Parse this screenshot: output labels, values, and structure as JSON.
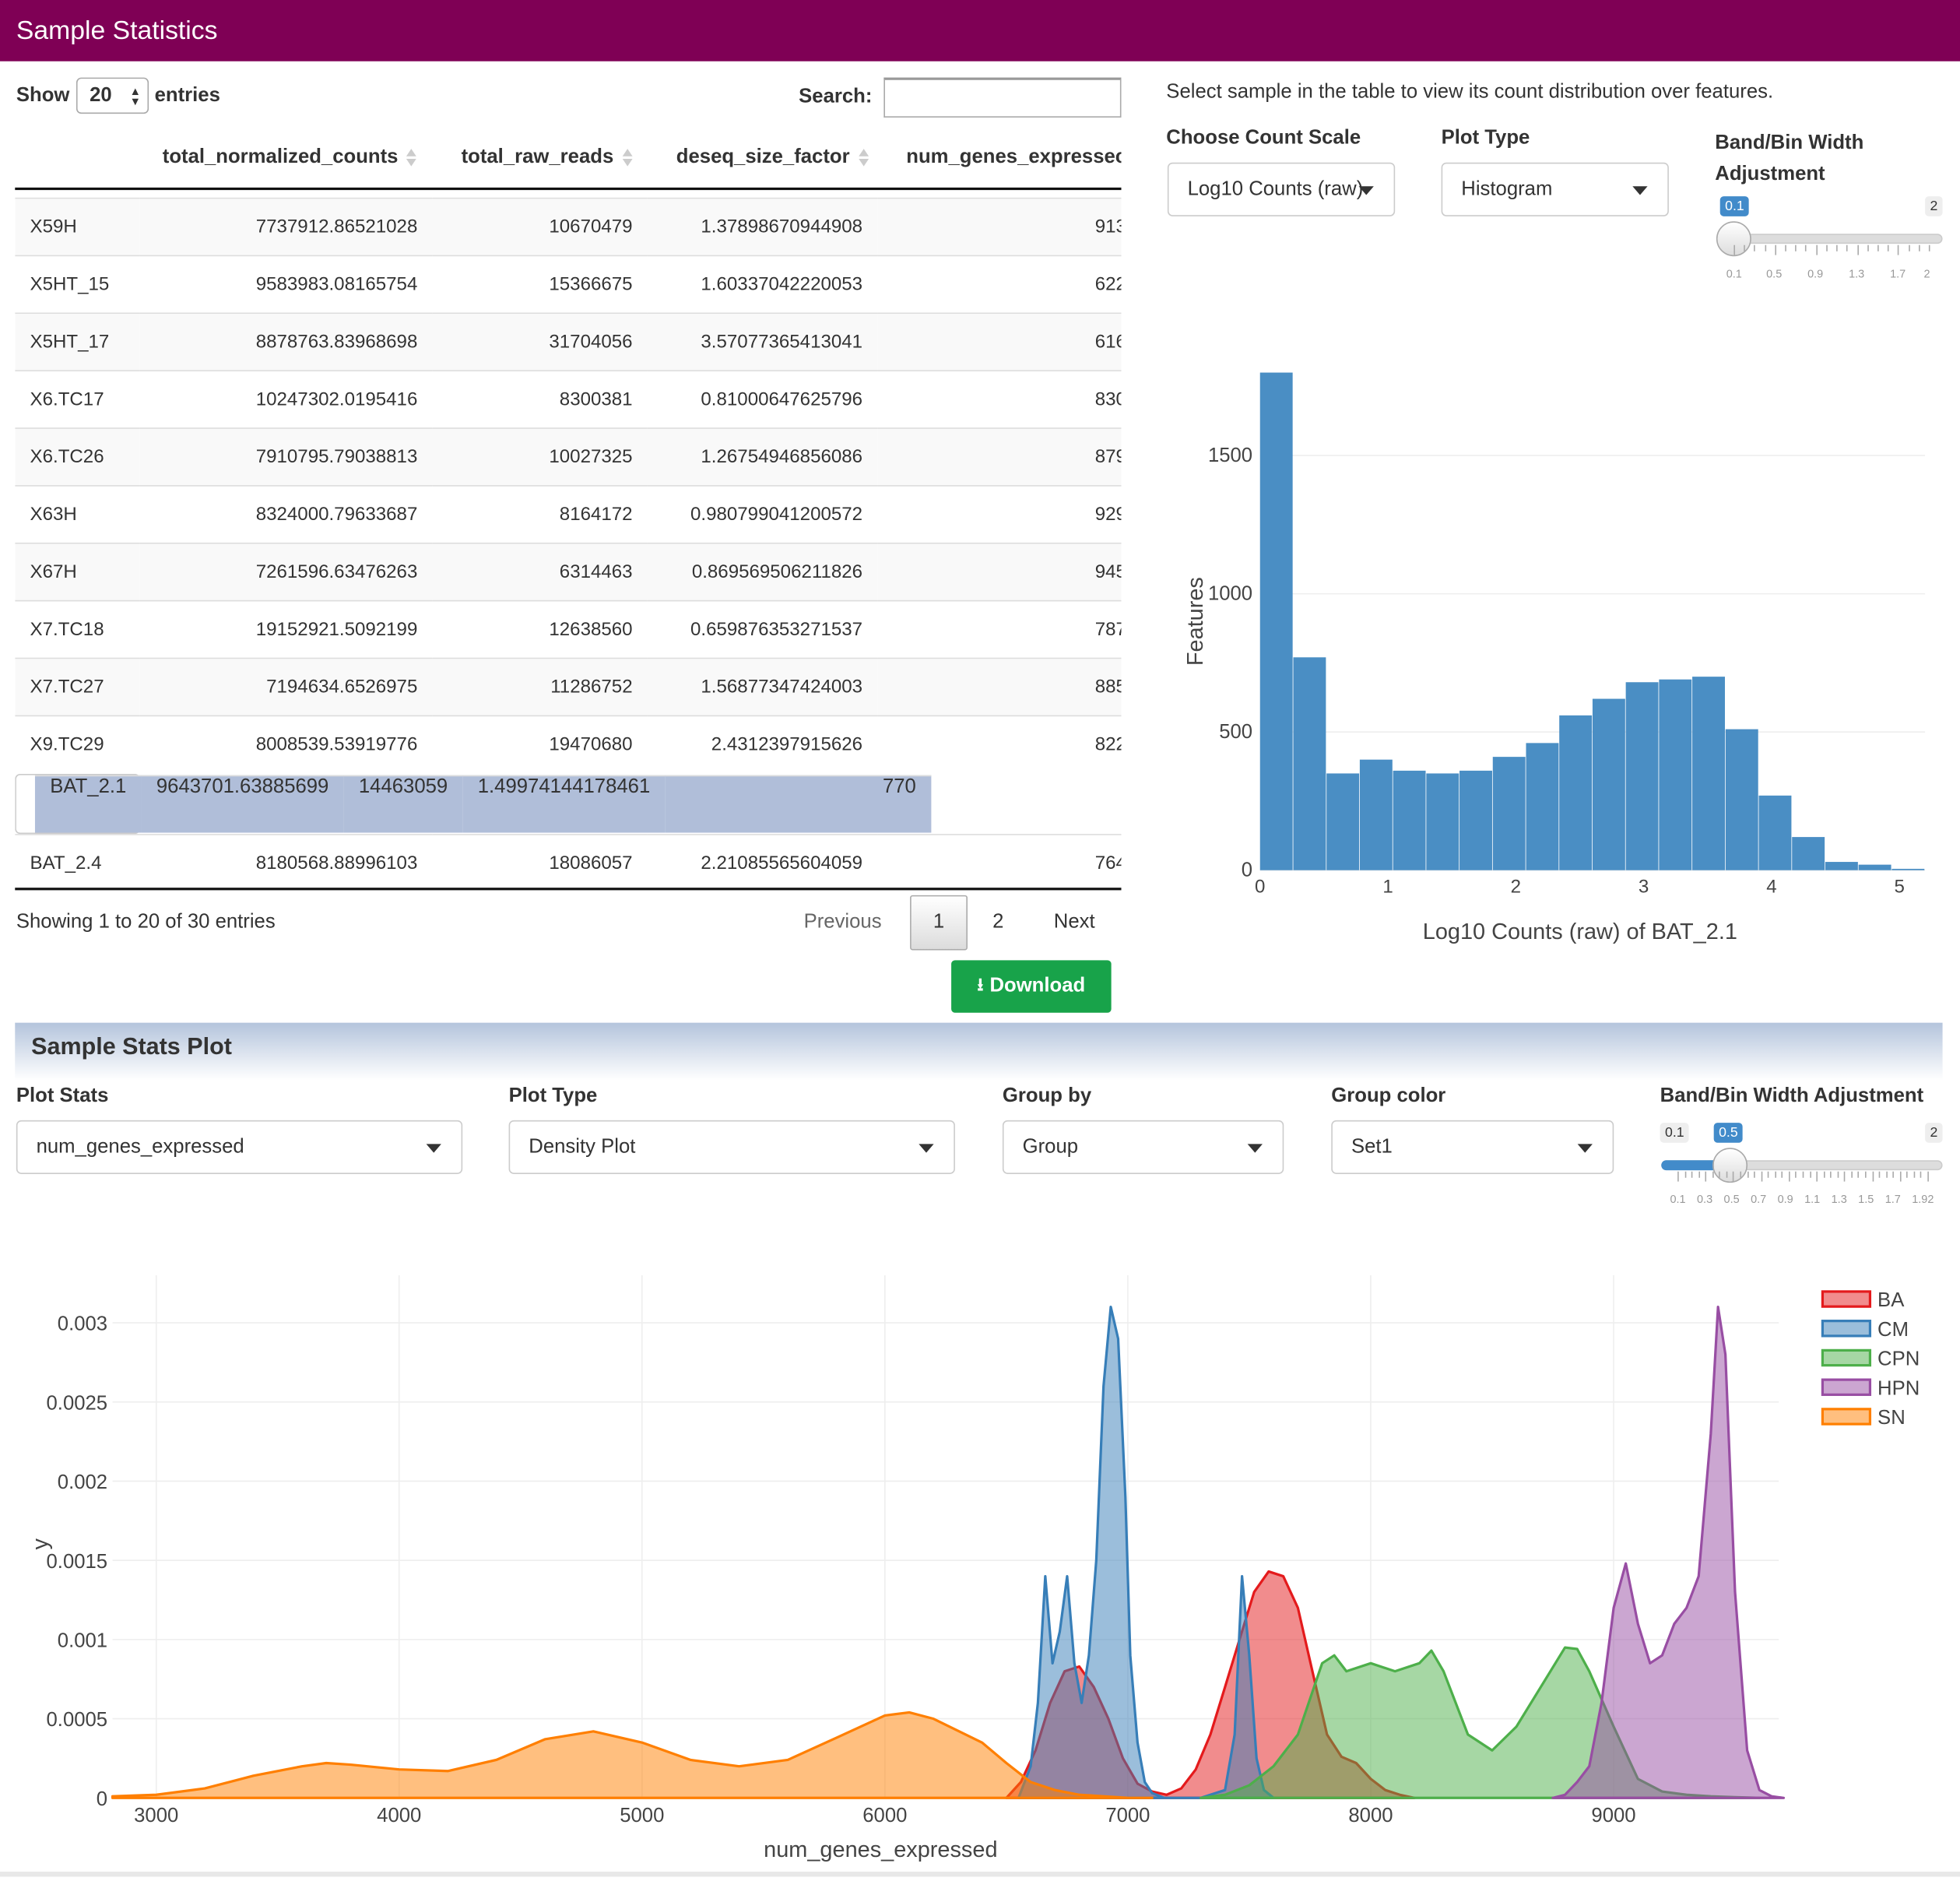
{
  "header": {
    "title": "Sample Statistics"
  },
  "table_controls": {
    "show_label": "Show",
    "entries_value": "20",
    "entries_label": "entries",
    "search_label": "Search:"
  },
  "table": {
    "columns": [
      "total_normalized_counts",
      "total_raw_reads",
      "deseq_size_factor",
      "num_genes_expressec"
    ],
    "rows": [
      {
        "sample": "X59H",
        "norm": "7737912.86521028",
        "raw": "10670479",
        "size": "1.37898670944908",
        "genes": "913"
      },
      {
        "sample": "X5HT_15",
        "norm": "9583983.08165754",
        "raw": "15366675",
        "size": "1.60337042220053",
        "genes": "622"
      },
      {
        "sample": "X5HT_17",
        "norm": "8878763.83968698",
        "raw": "31704056",
        "size": "3.57077365413041",
        "genes": "616"
      },
      {
        "sample": "X6.TC17",
        "norm": "10247302.0195416",
        "raw": "8300381",
        "size": "0.81000647625796",
        "genes": "830"
      },
      {
        "sample": "X6.TC26",
        "norm": "7910795.79038813",
        "raw": "10027325",
        "size": "1.26754946856086",
        "genes": "879"
      },
      {
        "sample": "X63H",
        "norm": "8324000.79633687",
        "raw": "8164172",
        "size": "0.980799041200572",
        "genes": "929"
      },
      {
        "sample": "X67H",
        "norm": "7261596.63476263",
        "raw": "6314463",
        "size": "0.869569506211826",
        "genes": "945"
      },
      {
        "sample": "X7.TC18",
        "norm": "19152921.5092199",
        "raw": "12638560",
        "size": "0.659876353271537",
        "genes": "787"
      },
      {
        "sample": "X7.TC27",
        "norm": "7194634.6526975",
        "raw": "11286752",
        "size": "1.56877347424003",
        "genes": "885"
      },
      {
        "sample": "X9.TC29",
        "norm": "8008539.53919776",
        "raw": "19470680",
        "size": "2.4312397915626",
        "genes": "822"
      },
      {
        "sample": "BAT_2.1",
        "norm": "9643701.63885699",
        "raw": "14463059",
        "size": "1.49974144178461",
        "genes": "770"
      },
      {
        "sample": "BAT_2.4",
        "norm": "8180568.88996103",
        "raw": "18086057",
        "size": "2.21085565604059",
        "genes": "764"
      }
    ],
    "selected_row": 10,
    "info": "Showing 1 to 20 of 30 entries",
    "pagination": {
      "previous": "Previous",
      "pages": [
        "1",
        "2"
      ],
      "next": "Next"
    },
    "download_label": "Download"
  },
  "right_panel": {
    "instruction": "Select sample in the table to view its count distribution over features.",
    "count_scale_label": "Choose Count Scale",
    "count_scale_value": "Log10 Counts (raw)",
    "plot_type_label": "Plot Type",
    "plot_type_value": "Histogram",
    "bw_label_1": "Band/Bin Width",
    "bw_label_2": "Adjustment",
    "slider": {
      "min": "0.1",
      "max": "2",
      "value": "0.1",
      "ticks": [
        "0.1",
        "0.5",
        "0.9",
        "1.3",
        "1.7",
        "2"
      ]
    }
  },
  "stats_panel": {
    "title": "Sample Stats Plot",
    "plot_stats_label": "Plot Stats",
    "plot_stats_value": "num_genes_expressed",
    "plot_type_label": "Plot Type",
    "plot_type_value": "Density Plot",
    "group_by_label": "Group by",
    "group_by_value": "Group",
    "group_color_label": "Group color",
    "group_color_value": "Set1",
    "bw_label": "Band/Bin Width Adjustment",
    "slider": {
      "min": "0.1",
      "max": "2",
      "value": "0.5",
      "ticks": [
        "0.1",
        "0.3",
        "0.5",
        "0.7",
        "0.9",
        "1.1",
        "1.3",
        "1.5",
        "1.7",
        "1.92"
      ]
    }
  },
  "colors": {
    "brand": "#7f0055",
    "histogram": "#4a8ec4",
    "download": "#18a34a",
    "selected_row": "#b0bed9"
  },
  "chart_data": [
    {
      "type": "bar",
      "chart": "histogram",
      "xlabel": "Log10 Counts (raw) of BAT_2.1",
      "ylabel": "Features",
      "xlim": [
        0,
        5.2
      ],
      "ylim": [
        0,
        1800
      ],
      "xticks": [
        "0",
        "1",
        "2",
        "3",
        "4",
        "5"
      ],
      "yticks": [
        "0",
        "500",
        "1000",
        "1500"
      ],
      "bin_width": 0.26,
      "bins": [
        0,
        0.26,
        0.52,
        0.78,
        1.04,
        1.3,
        1.56,
        1.82,
        2.08,
        2.34,
        2.6,
        2.86,
        3.12,
        3.38,
        3.64,
        3.9,
        4.16,
        4.42,
        4.68,
        4.94
      ],
      "values": [
        1800,
        770,
        350,
        400,
        360,
        350,
        360,
        410,
        460,
        560,
        620,
        680,
        690,
        700,
        510,
        270,
        120,
        30,
        20,
        5
      ]
    },
    {
      "type": "area",
      "chart": "density",
      "xlabel": "num_genes_expressed",
      "ylabel": "y",
      "xlim": [
        2820,
        9680
      ],
      "ylim": [
        0,
        0.0033
      ],
      "xticks": [
        "3000",
        "4000",
        "5000",
        "6000",
        "7000",
        "8000",
        "9000"
      ],
      "yticks": [
        "0",
        "0.0005",
        "0.001",
        "0.0015",
        "0.002",
        "0.0025",
        "0.003"
      ],
      "series": [
        {
          "name": "BA",
          "color": "#e41a1c",
          "x": [
            6500,
            6560,
            6620,
            6680,
            6740,
            6800,
            6860,
            6920,
            6980,
            7040,
            7100,
            7160,
            7220,
            7280,
            7340,
            7400,
            7460,
            7520,
            7580,
            7640,
            7700,
            7760,
            7820,
            7880,
            7940,
            8000,
            8060,
            8120,
            8180
          ],
          "y": [
            0,
            0.0001,
            0.0003,
            0.0006,
            0.0008,
            0.00083,
            0.0007,
            0.0005,
            0.00025,
            9e-05,
            4e-05,
            2e-05,
            6e-05,
            0.00018,
            0.0004,
            0.0007,
            0.001,
            0.0013,
            0.00143,
            0.0014,
            0.0012,
            0.0008,
            0.0004,
            0.00026,
            0.00022,
            0.00012,
            5e-05,
            2e-05,
            0
          ]
        },
        {
          "name": "CM",
          "color": "#377eb8",
          "x": [
            6550,
            6600,
            6630,
            6660,
            6690,
            6720,
            6750,
            6780,
            6810,
            6840,
            6870,
            6900,
            6930,
            6960,
            6990,
            7010,
            7040,
            7070,
            7100,
            7150,
            7200,
            7300,
            7400,
            7440,
            7470,
            7500,
            7530,
            7560,
            7600
          ],
          "y": [
            0,
            0.0002,
            0.0006,
            0.0014,
            0.00085,
            0.00105,
            0.0014,
            0.00085,
            0.0006,
            0.0009,
            0.0015,
            0.0026,
            0.0031,
            0.0029,
            0.0019,
            0.0009,
            0.00035,
            0.0001,
            3e-05,
            0,
            0,
            0,
            5e-05,
            0.0004,
            0.0014,
            0.0009,
            0.00025,
            5e-05,
            0
          ]
        },
        {
          "name": "CPN",
          "color": "#4daf4a",
          "x": [
            7300,
            7400,
            7500,
            7600,
            7700,
            7800,
            7850,
            7900,
            8000,
            8100,
            8200,
            8250,
            8300,
            8400,
            8500,
            8600,
            8700,
            8800,
            8850,
            8900,
            9000,
            9100,
            9200,
            9300,
            9400,
            9500,
            9600
          ],
          "y": [
            0,
            2e-05,
            8e-05,
            0.0002,
            0.0004,
            0.00085,
            0.0009,
            0.0008,
            0.00085,
            0.0008,
            0.00085,
            0.00093,
            0.0008,
            0.0004,
            0.0003,
            0.00045,
            0.0007,
            0.00095,
            0.00094,
            0.0008,
            0.00045,
            0.00012,
            4e-05,
            2e-05,
            1e-05,
            5e-06,
            0
          ]
        },
        {
          "name": "HPN",
          "color": "#984ea3",
          "x": [
            8750,
            8800,
            8850,
            8900,
            8950,
            9000,
            9050,
            9100,
            9150,
            9200,
            9250,
            9300,
            9350,
            9400,
            9430,
            9460,
            9500,
            9550,
            9600,
            9650,
            9700
          ],
          "y": [
            0,
            2e-05,
            0.0001,
            0.0002,
            0.0006,
            0.0012,
            0.00148,
            0.0011,
            0.00085,
            0.0009,
            0.0011,
            0.0012,
            0.0014,
            0.0023,
            0.0031,
            0.0028,
            0.0013,
            0.0003,
            5e-05,
            1e-05,
            0
          ]
        },
        {
          "name": "SN",
          "color": "#ff7f00",
          "x": [
            2820,
            3000,
            3200,
            3400,
            3600,
            3700,
            3800,
            4000,
            4200,
            4400,
            4600,
            4800,
            5000,
            5200,
            5400,
            5600,
            5800,
            6000,
            6100,
            6200,
            6400,
            6500,
            6600,
            6700,
            6800,
            6900,
            7000,
            7100
          ],
          "y": [
            1e-05,
            2e-05,
            6e-05,
            0.00014,
            0.0002,
            0.00022,
            0.00021,
            0.00018,
            0.00017,
            0.00024,
            0.00037,
            0.00042,
            0.00035,
            0.00024,
            0.0002,
            0.00024,
            0.00038,
            0.00052,
            0.00054,
            0.0005,
            0.00035,
            0.00022,
            0.0001,
            5e-05,
            2e-05,
            1e-05,
            0,
            0
          ]
        }
      ]
    }
  ]
}
